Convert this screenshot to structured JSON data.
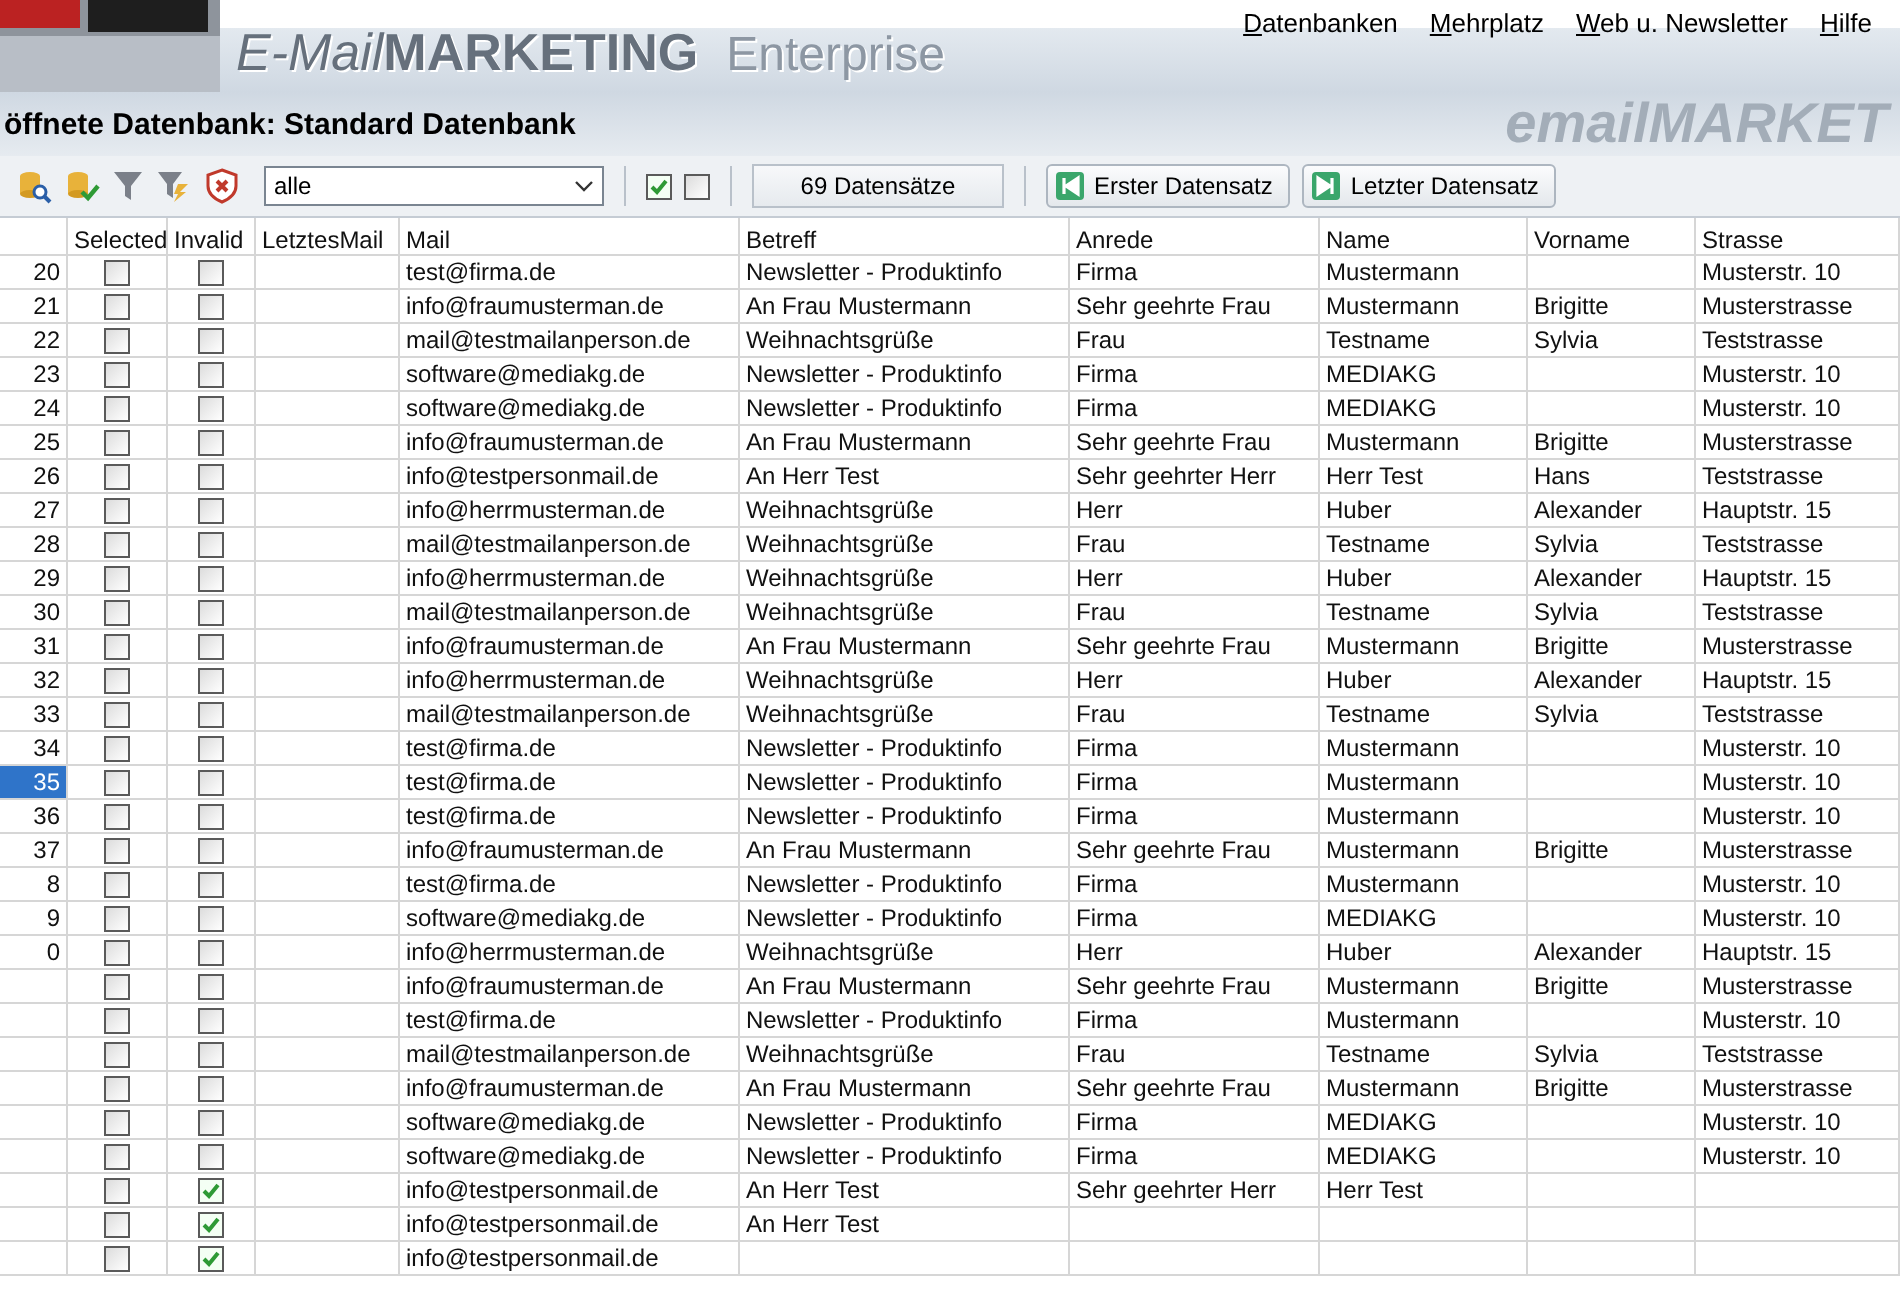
{
  "menu": [
    {
      "label": "Datenbanken"
    },
    {
      "label": "Mehrplatz"
    },
    {
      "label": "Web u. Newsletter"
    },
    {
      "label": "Hilfe"
    }
  ],
  "banner": {
    "product_name": "E-Mail",
    "product_name_bold": "MARKETING",
    "edition": "Enterprise",
    "background_text": "emailMARKET"
  },
  "database_label": "öffnete Datenbank: Standard Datenbank",
  "toolbar": {
    "filter": {
      "value": "alle"
    },
    "toggles": [
      {
        "checked": true
      },
      {
        "checked": false
      }
    ],
    "record_count": "69 Datensätze",
    "buttons": [
      {
        "label": "Erster Datensatz",
        "kind": "first"
      },
      {
        "label": "Letzter Datensatz",
        "kind": "last"
      }
    ]
  },
  "table": {
    "columns": [
      "Selected",
      "Invalid",
      "LetztesMail",
      "Mail",
      "Betreff",
      "Anrede",
      "Name",
      "Vorname",
      "Strasse"
    ],
    "rows": [
      {
        "number": "20",
        "selected": false,
        "sel_checked": false,
        "invalid": false,
        "mail": "test@firma.de",
        "betreff": "Newsletter - Produktinfo",
        "anrede": "Firma",
        "name": "Mustermann",
        "strasse": "Musterstr. 10"
      },
      {
        "number": "21",
        "selected": false,
        "sel_checked": false,
        "invalid": false,
        "mail": "info@fraumusterman.de",
        "betreff": "An Frau Mustermann",
        "anrede": "Sehr geehrte Frau",
        "name": "Mustermann",
        "vorname": "Brigitte",
        "strasse": "Musterstrasse"
      },
      {
        "number": "22",
        "selected": false,
        "sel_checked": false,
        "invalid": false,
        "mail": "mail@testmailanperson.de",
        "betreff": "Weihnachtsgrüße",
        "anrede": "Frau",
        "name": "Testname",
        "vorname": "Sylvia",
        "strasse": "Teststrasse"
      },
      {
        "number": "23",
        "selected": false,
        "sel_checked": false,
        "invalid": false,
        "mail": "software@mediakg.de",
        "betreff": "Newsletter - Produktinfo",
        "anrede": "Firma",
        "name": "MEDIAKG",
        "strasse": "Musterstr. 10"
      },
      {
        "number": "24",
        "selected": false,
        "sel_checked": false,
        "invalid": false,
        "mail": "software@mediakg.de",
        "betreff": "Newsletter - Produktinfo",
        "anrede": "Firma",
        "name": "MEDIAKG",
        "strasse": "Musterstr. 10"
      },
      {
        "number": "25",
        "selected": false,
        "sel_checked": false,
        "invalid": false,
        "mail": "info@fraumusterman.de",
        "betreff": "An Frau Mustermann",
        "anrede": "Sehr geehrte Frau",
        "name": "Mustermann",
        "vorname": "Brigitte",
        "strasse": "Musterstrasse"
      },
      {
        "number": "26",
        "selected": false,
        "sel_checked": false,
        "invalid": false,
        "mail": "info@testpersonmail.de",
        "betreff": "An Herr Test",
        "anrede": "Sehr geehrter Herr",
        "name": "Herr Test",
        "vorname": "Hans",
        "strasse": "Teststrasse"
      },
      {
        "number": "27",
        "selected": false,
        "sel_checked": false,
        "invalid": false,
        "mail": "info@herrmusterman.de",
        "betreff": "Weihnachtsgrüße",
        "anrede": "Herr",
        "name": "Huber",
        "vorname": "Alexander",
        "strasse": "Hauptstr. 15"
      },
      {
        "number": "28",
        "selected": false,
        "sel_checked": false,
        "invalid": false,
        "mail": "mail@testmailanperson.de",
        "betreff": "Weihnachtsgrüße",
        "anrede": "Frau",
        "name": "Testname",
        "vorname": "Sylvia",
        "strasse": "Teststrasse"
      },
      {
        "number": "29",
        "selected": false,
        "sel_checked": false,
        "invalid": false,
        "mail": "info@herrmusterman.de",
        "betreff": "Weihnachtsgrüße",
        "anrede": "Herr",
        "name": "Huber",
        "vorname": "Alexander",
        "strasse": "Hauptstr. 15"
      },
      {
        "number": "30",
        "selected": false,
        "sel_checked": false,
        "invalid": false,
        "mail": "mail@testmailanperson.de",
        "betreff": "Weihnachtsgrüße",
        "anrede": "Frau",
        "name": "Testname",
        "vorname": "Sylvia",
        "strasse": "Teststrasse"
      },
      {
        "number": "31",
        "selected": false,
        "sel_checked": false,
        "invalid": false,
        "mail": "info@fraumusterman.de",
        "betreff": "An Frau Mustermann",
        "anrede": "Sehr geehrte Frau",
        "name": "Mustermann",
        "vorname": "Brigitte",
        "strasse": "Musterstrasse"
      },
      {
        "number": "32",
        "selected": false,
        "sel_checked": false,
        "invalid": false,
        "mail": "info@herrmusterman.de",
        "betreff": "Weihnachtsgrüße",
        "anrede": "Herr",
        "name": "Huber",
        "vorname": "Alexander",
        "strasse": "Hauptstr. 15"
      },
      {
        "number": "33",
        "selected": false,
        "sel_checked": false,
        "invalid": false,
        "mail": "mail@testmailanperson.de",
        "betreff": "Weihnachtsgrüße",
        "anrede": "Frau",
        "name": "Testname",
        "vorname": "Sylvia",
        "strasse": "Teststrasse"
      },
      {
        "number": "34",
        "selected": false,
        "sel_checked": false,
        "invalid": false,
        "mail": "test@firma.de",
        "betreff": "Newsletter - Produktinfo",
        "anrede": "Firma",
        "name": "Mustermann",
        "strasse": "Musterstr. 10"
      },
      {
        "number": "35",
        "selected": true,
        "sel_checked": false,
        "invalid": false,
        "mail": "test@firma.de",
        "betreff": "Newsletter - Produktinfo",
        "anrede": "Firma",
        "name": "Mustermann",
        "strasse": "Musterstr. 10"
      },
      {
        "number": "36",
        "selected": false,
        "sel_checked": false,
        "invalid": false,
        "mail": "test@firma.de",
        "betreff": "Newsletter - Produktinfo",
        "anrede": "Firma",
        "name": "Mustermann",
        "strasse": "Musterstr. 10"
      },
      {
        "number": "37",
        "selected": false,
        "sel_checked": false,
        "invalid": false,
        "mail": "info@fraumusterman.de",
        "betreff": "An Frau Mustermann",
        "anrede": "Sehr geehrte Frau",
        "name": "Mustermann",
        "vorname": "Brigitte",
        "strasse": "Musterstrasse"
      },
      {
        "number": "8",
        "selected": false,
        "sel_checked": false,
        "invalid": false,
        "mail": "test@firma.de",
        "betreff": "Newsletter - Produktinfo",
        "anrede": "Firma",
        "name": "Mustermann",
        "strasse": "Musterstr. 10"
      },
      {
        "number": "9",
        "selected": false,
        "sel_checked": false,
        "invalid": false,
        "mail": "software@mediakg.de",
        "betreff": "Newsletter - Produktinfo",
        "anrede": "Firma",
        "name": "MEDIAKG",
        "strasse": "Musterstr. 10"
      },
      {
        "number": "0",
        "selected": false,
        "sel_checked": false,
        "invalid": false,
        "mail": "info@herrmusterman.de",
        "betreff": "Weihnachtsgrüße",
        "anrede": "Herr",
        "name": "Huber",
        "vorname": "Alexander",
        "strasse": "Hauptstr. 15"
      },
      {
        "selected": false,
        "sel_checked": false,
        "invalid": false,
        "mail": "info@fraumusterman.de",
        "betreff": "An Frau Mustermann",
        "anrede": "Sehr geehrte Frau",
        "name": "Mustermann",
        "vorname": "Brigitte",
        "strasse": "Musterstrasse"
      },
      {
        "selected": false,
        "sel_checked": false,
        "invalid": false,
        "mail": "test@firma.de",
        "betreff": "Newsletter - Produktinfo",
        "anrede": "Firma",
        "name": "Mustermann",
        "strasse": "Musterstr. 10"
      },
      {
        "selected": false,
        "sel_checked": false,
        "invalid": false,
        "mail": "mail@testmailanperson.de",
        "betreff": "Weihnachtsgrüße",
        "anrede": "Frau",
        "name": "Testname",
        "vorname": "Sylvia",
        "strasse": "Teststrasse"
      },
      {
        "selected": false,
        "sel_checked": false,
        "invalid": false,
        "mail": "info@fraumusterman.de",
        "betreff": "An Frau Mustermann",
        "anrede": "Sehr geehrte Frau",
        "name": "Mustermann",
        "vorname": "Brigitte",
        "strasse": "Musterstrasse"
      },
      {
        "selected": false,
        "sel_checked": false,
        "invalid": false,
        "mail": "software@mediakg.de",
        "betreff": "Newsletter - Produktinfo",
        "anrede": "Firma",
        "name": "MEDIAKG",
        "strasse": "Musterstr. 10"
      },
      {
        "selected": false,
        "sel_checked": false,
        "invalid": false,
        "mail": "software@mediakg.de",
        "betreff": "Newsletter - Produktinfo",
        "anrede": "Firma",
        "name": "MEDIAKG",
        "strasse": "Musterstr. 10"
      },
      {
        "selected": false,
        "sel_checked": false,
        "invalid": true,
        "mail": "info@testpersonmail.de",
        "betreff": "An Herr Test",
        "anrede": "Sehr geehrter Herr",
        "name": "Herr Test"
      },
      {
        "selected": false,
        "sel_checked": false,
        "invalid": true,
        "mail": "info@testpersonmail.de",
        "betreff": "An Herr Test"
      },
      {
        "selected": false,
        "sel_checked": false,
        "invalid": true,
        "mail": "info@testpersonmail.de"
      }
    ]
  }
}
